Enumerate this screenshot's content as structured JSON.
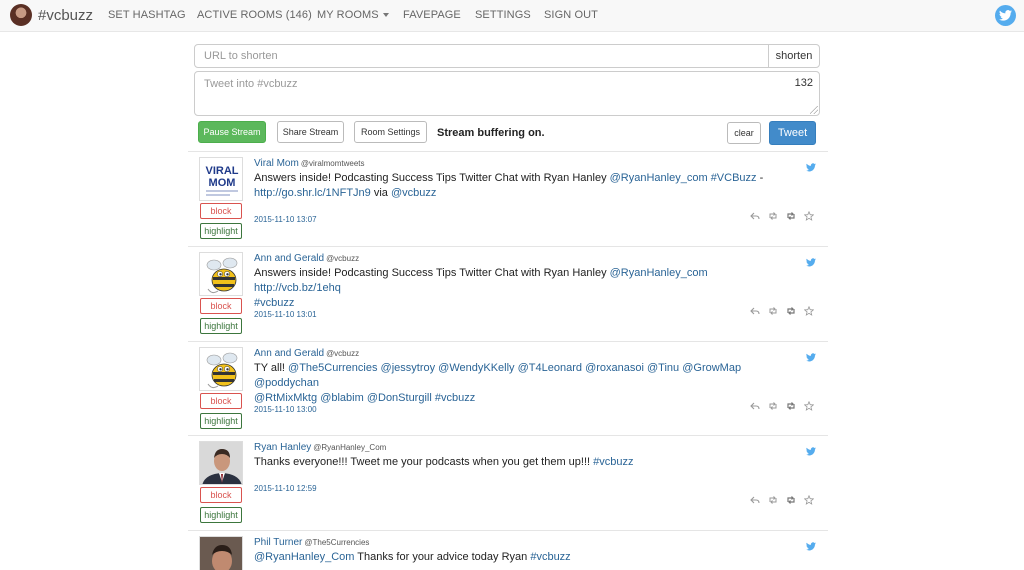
{
  "nav": {
    "brand": "#vcbuzz",
    "items": [
      "SET HASHTAG",
      "ACTIVE ROOMS (146)",
      "MY ROOMS",
      "FAVEPAGE",
      "SETTINGS",
      "SIGN OUT"
    ]
  },
  "form": {
    "url_placeholder": "URL to shorten",
    "shorten_label": "shorten",
    "tweet_placeholder": "Tweet into #vcbuzz",
    "char_count": "132",
    "pause_label": "Pause Stream",
    "share_label": "Share Stream",
    "room_settings_label": "Room Settings",
    "buffer_status": "Stream buffering on.",
    "clear_label": "clear",
    "tweet_label": "Tweet"
  },
  "tag_labels": {
    "block": "block",
    "highlight": "highlight"
  },
  "colors": {
    "twitter": "#55acee",
    "link": "#2a6496",
    "pause": "#5cb85c",
    "tweet": "#428bca",
    "block": "#d9534f",
    "highlight": "#3c763d"
  },
  "tweets": [
    {
      "author": "Viral Mom",
      "handle": "@viralmomtweets",
      "text_lines": [
        [
          {
            "t": "Answers inside! Podcasting Success Tips Twitter Chat with Ryan Hanley "
          },
          {
            "t": "@RyanHanley_com",
            "link": true
          },
          {
            "t": " "
          },
          {
            "t": "#VCBuzz",
            "link": true
          },
          {
            "t": " -"
          }
        ],
        [
          {
            "t": "http://go.shr.lc/1NFTJn9",
            "link": true
          },
          {
            "t": " via "
          },
          {
            "t": "@vcbuzz",
            "link": true
          }
        ]
      ],
      "time": "2015-11-10 13:07",
      "avatar": "viral-mom"
    },
    {
      "author": "Ann and Gerald",
      "handle": "@vcbuzz",
      "text_lines": [
        [
          {
            "t": "Answers inside! Podcasting Success Tips Twitter Chat with Ryan Hanley "
          },
          {
            "t": "@RyanHanley_com",
            "link": true
          },
          {
            "t": " "
          },
          {
            "t": "http://vcb.bz/1ehq",
            "link": true
          }
        ],
        [
          {
            "t": "#vcbuzz",
            "link": true
          }
        ]
      ],
      "time": "2015-11-10 13:01",
      "avatar": "bee"
    },
    {
      "author": "Ann and Gerald",
      "handle": "@vcbuzz",
      "text_lines": [
        [
          {
            "t": "TY all! "
          },
          {
            "t": "@The5Currencies",
            "link": true
          },
          {
            "t": " "
          },
          {
            "t": "@jessytroy",
            "link": true
          },
          {
            "t": " "
          },
          {
            "t": "@WendyKKelly",
            "link": true
          },
          {
            "t": " "
          },
          {
            "t": "@T4Leonard",
            "link": true
          },
          {
            "t": " "
          },
          {
            "t": "@roxanasoi",
            "link": true
          },
          {
            "t": " "
          },
          {
            "t": "@Tinu",
            "link": true
          },
          {
            "t": " "
          },
          {
            "t": "@GrowMap",
            "link": true
          },
          {
            "t": " "
          },
          {
            "t": "@poddychan",
            "link": true
          }
        ],
        [
          {
            "t": "@RtMixMktg",
            "link": true
          },
          {
            "t": " "
          },
          {
            "t": "@blabim",
            "link": true
          },
          {
            "t": " "
          },
          {
            "t": "@DonSturgill",
            "link": true
          },
          {
            "t": " "
          },
          {
            "t": "#vcbuzz",
            "link": true
          }
        ]
      ],
      "time": "2015-11-10 13:00",
      "avatar": "bee"
    },
    {
      "author": "Ryan Hanley",
      "handle": "@RyanHanley_Com",
      "text_lines": [
        [
          {
            "t": "Thanks everyone!!! Tweet me your podcasts when you get them up!!! "
          },
          {
            "t": "#vcbuzz",
            "link": true
          }
        ]
      ],
      "time": "2015-11-10 12:59",
      "avatar": "person"
    },
    {
      "author": "Phil Turner",
      "handle": "@The5Currencies",
      "text_lines": [
        [
          {
            "t": "@RyanHanley_Com",
            "link": true
          },
          {
            "t": " Thanks for your advice today Ryan "
          },
          {
            "t": "#vcbuzz",
            "link": true
          }
        ]
      ],
      "time": "",
      "avatar": "person2"
    }
  ]
}
